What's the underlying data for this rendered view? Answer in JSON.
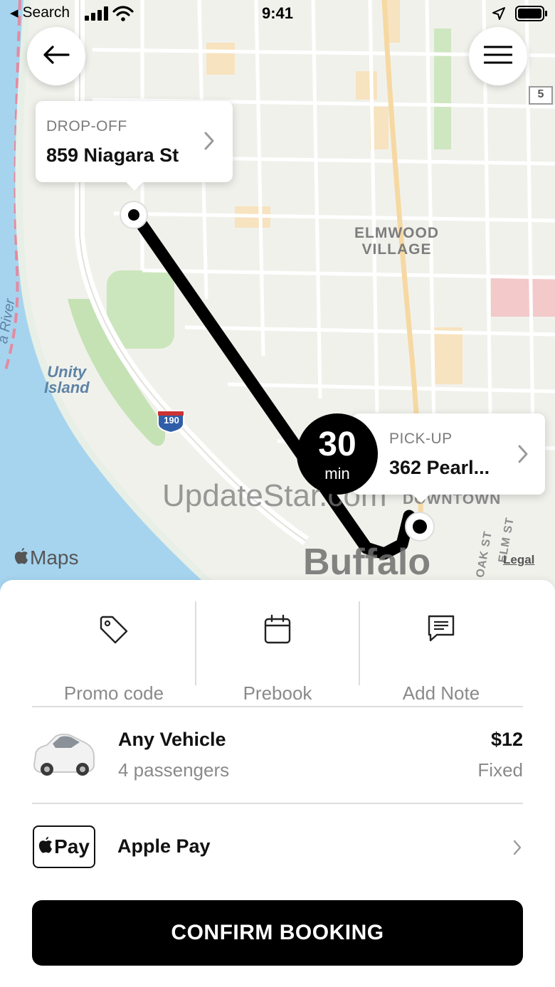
{
  "status_bar": {
    "back_app": "Search",
    "time": "9:41"
  },
  "map": {
    "labels": {
      "neighborhood_line1": "ELMWOOD",
      "neighborhood_line2": "VILLAGE",
      "island_line1": "Unity",
      "island_line2": "Island",
      "river": "a River",
      "interstate": "190",
      "route": "5",
      "downtown": "DOWNTOWN",
      "street1": "OAK ST",
      "street2": "ELM ST",
      "city": "Buffalo"
    },
    "brand": "Maps",
    "legal": "Legal",
    "watermark": "UpdateStar.com",
    "water_color": "#a6d4ef",
    "park_color": "#c5e2b5",
    "route_color": "#000000"
  },
  "dropoff": {
    "label": "DROP-OFF",
    "address": "859 Niagara St"
  },
  "pickup": {
    "label": "PICK-UP",
    "address": "362 Pearl..."
  },
  "eta": {
    "value": "30",
    "unit": "min"
  },
  "actions": [
    {
      "label": "Promo code",
      "icon": "tag-icon"
    },
    {
      "label": "Prebook",
      "icon": "calendar-icon"
    },
    {
      "label": "Add Note",
      "icon": "note-icon"
    }
  ],
  "vehicle": {
    "name": "Any Vehicle",
    "capacity": "4 passengers",
    "price": "$12",
    "price_type": "Fixed"
  },
  "payment": {
    "badge": "Pay",
    "method": "Apple Pay"
  },
  "confirm_label": "CONFIRM BOOKING"
}
